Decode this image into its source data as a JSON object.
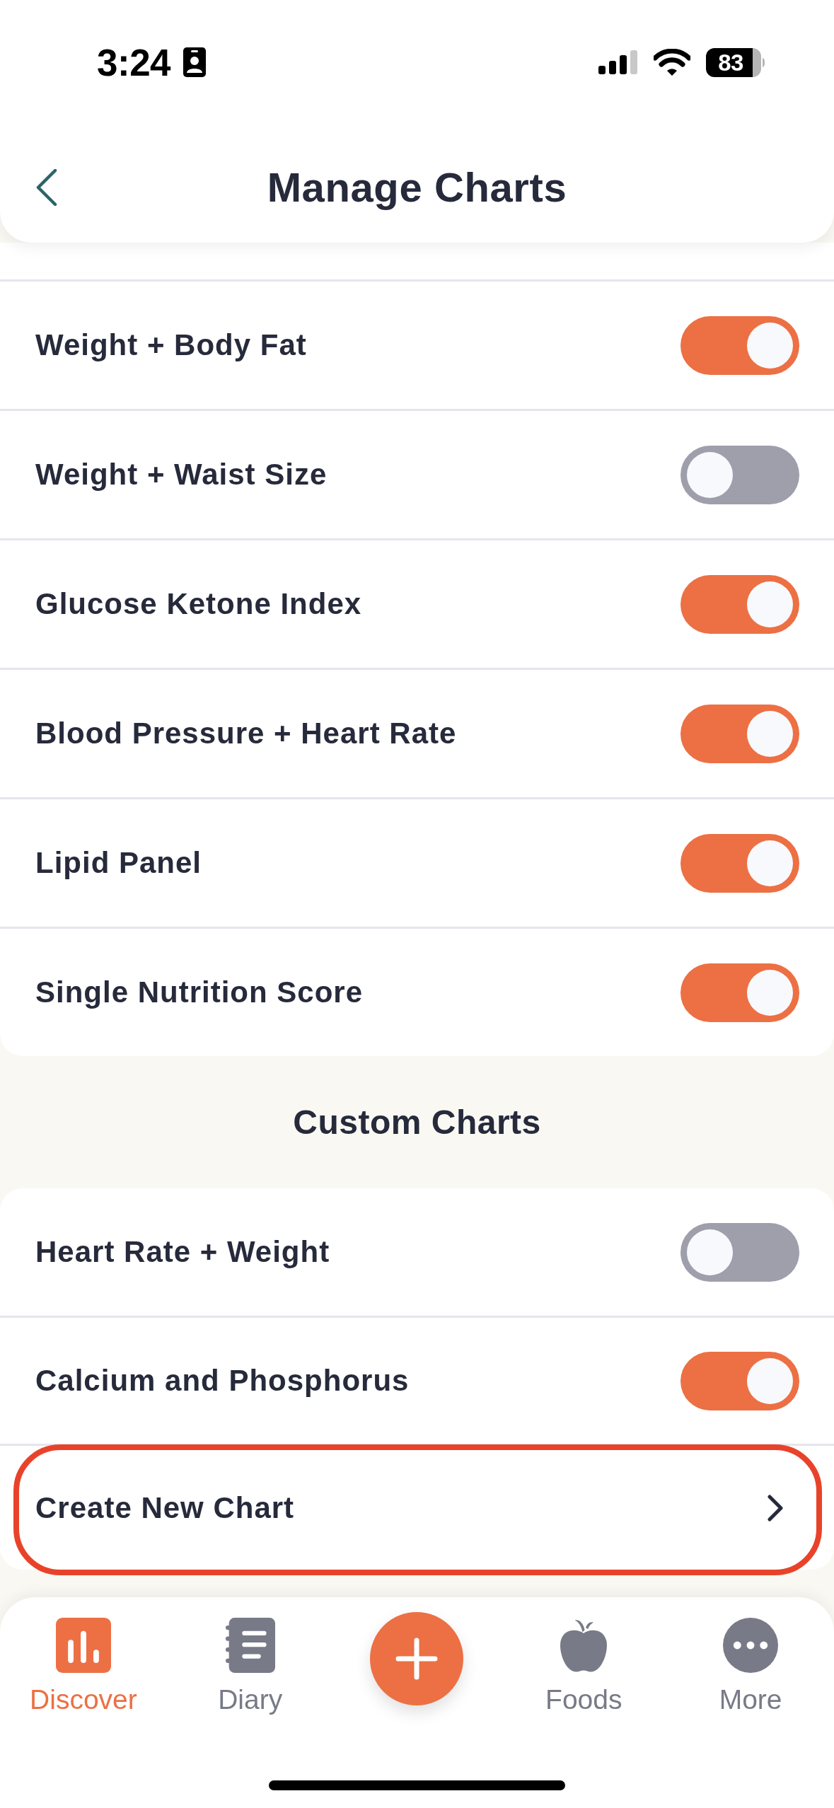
{
  "status_bar": {
    "time": "3:24",
    "battery": "83"
  },
  "header": {
    "title": "Manage Charts"
  },
  "charts": [
    {
      "label": "Weight + Body Fat",
      "on": true
    },
    {
      "label": "Weight + Waist Size",
      "on": false
    },
    {
      "label": "Glucose Ketone Index",
      "on": true
    },
    {
      "label": "Blood Pressure + Heart Rate",
      "on": true
    },
    {
      "label": "Lipid Panel",
      "on": true
    },
    {
      "label": "Single Nutrition Score",
      "on": true
    }
  ],
  "custom_charts": {
    "title": "Custom Charts",
    "items": [
      {
        "label": "Heart Rate + Weight",
        "on": false
      },
      {
        "label": "Calcium and Phosphorus",
        "on": true
      }
    ],
    "create": {
      "label": "Create New Chart",
      "highlighted": true
    }
  },
  "tab_bar": [
    {
      "kind": "tab",
      "label": "Discover",
      "selected": true
    },
    {
      "kind": "tab",
      "label": "Diary",
      "selected": false
    },
    {
      "kind": "action"
    },
    {
      "kind": "tab",
      "label": "Foods",
      "selected": false
    },
    {
      "kind": "tab",
      "label": "More",
      "selected": false
    }
  ]
}
